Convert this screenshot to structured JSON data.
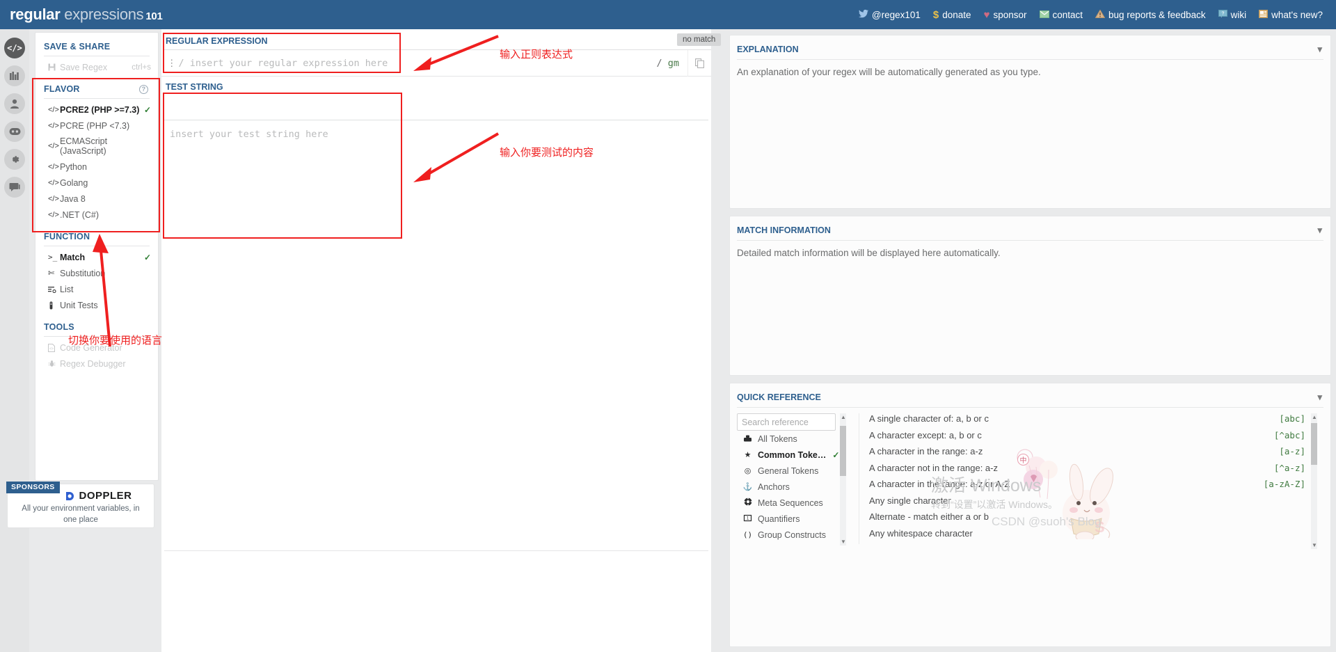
{
  "header": {
    "brand_regular": "regular",
    "brand_expressions": " expressions",
    "brand_101": "101",
    "nav": [
      {
        "icon": "twitter-icon",
        "glyph": "🐦",
        "label": "@regex101"
      },
      {
        "icon": "dollar-icon",
        "glyph": "$",
        "label": "donate"
      },
      {
        "icon": "heart-icon",
        "glyph": "♥",
        "label": "sponsor"
      },
      {
        "icon": "envelope-icon",
        "glyph": "✉",
        "label": "contact"
      },
      {
        "icon": "warning-icon",
        "glyph": "⚠",
        "label": "bug reports & feedback"
      },
      {
        "icon": "question-box-icon",
        "glyph": "?",
        "label": "wiki"
      },
      {
        "icon": "news-icon",
        "glyph": "☷",
        "label": "what's new?"
      }
    ]
  },
  "rail": [
    {
      "name": "code-icon",
      "glyph": "</>",
      "active": true
    },
    {
      "name": "library-icon",
      "glyph": "☷",
      "active": false
    },
    {
      "name": "account-icon",
      "glyph": "●",
      "active": false
    },
    {
      "name": "community-icon",
      "glyph": "◉",
      "active": false
    },
    {
      "name": "settings-icon",
      "glyph": "⚙",
      "active": false
    },
    {
      "name": "chat-icon",
      "glyph": "▣",
      "active": false
    }
  ],
  "sidebar": {
    "save_share_title": "SAVE & SHARE",
    "save_regex_label": "Save Regex",
    "save_regex_shortcut": "ctrl+s",
    "flavor_title": "FLAVOR",
    "flavor_help": "?",
    "flavors": [
      {
        "label": "PCRE2 (PHP >=7.3)",
        "selected": true
      },
      {
        "label": "PCRE (PHP <7.3)",
        "selected": false
      },
      {
        "label": "ECMAScript (JavaScript)",
        "selected": false
      },
      {
        "label": "Python",
        "selected": false
      },
      {
        "label": "Golang",
        "selected": false
      },
      {
        "label": "Java 8",
        "selected": false
      },
      {
        "label": ".NET (C#)",
        "selected": false
      }
    ],
    "function_title": "FUNCTION",
    "functions": [
      {
        "label": "Match",
        "icon": ">_",
        "selected": true
      },
      {
        "label": "Substitution",
        "icon": "✂",
        "selected": false
      },
      {
        "label": "List",
        "icon": "≡",
        "selected": false
      },
      {
        "label": "Unit Tests",
        "icon": "▮",
        "selected": false
      }
    ],
    "tools_title": "TOOLS",
    "tools": [
      {
        "label": "Code Generator",
        "icon": "⎘",
        "disabled": true
      },
      {
        "label": "Regex Debugger",
        "icon": "☣",
        "disabled": true
      }
    ]
  },
  "sponsors": {
    "tag": "SPONSORS",
    "name": "DOPPLER",
    "tagline": "All your environment variables, in one place"
  },
  "editor": {
    "regex_label": "REGULAR EXPRESSION",
    "regex_placeholder": "/ insert your regular expression here",
    "flags_slash": "/",
    "flags_value": "gm",
    "copy_icon": "⧉",
    "no_match_badge": "no match",
    "test_string_label": "TEST STRING",
    "test_string_placeholder": "insert your test string here"
  },
  "explanation": {
    "title": "EXPLANATION",
    "body": "An explanation of your regex will be automatically generated as you type."
  },
  "match_information": {
    "title": "MATCH INFORMATION",
    "body": "Detailed match information will be displayed here automatically."
  },
  "quick_reference": {
    "title": "QUICK REFERENCE",
    "search_placeholder": "Search reference",
    "categories": [
      {
        "label": "All Tokens",
        "icon": "▰",
        "selected": false
      },
      {
        "label": "Common Toke…",
        "icon": "★",
        "selected": true
      },
      {
        "label": "General Tokens",
        "icon": "◎",
        "selected": false
      },
      {
        "label": "Anchors",
        "icon": "⚓",
        "selected": false
      },
      {
        "label": "Meta Sequences",
        "icon": "❉",
        "selected": false
      },
      {
        "label": "Quantifiers",
        "icon": "⧉",
        "selected": false
      },
      {
        "label": "Group Constructs",
        "icon": "()",
        "selected": false
      }
    ],
    "entries": [
      {
        "desc": "A single character of: a, b or c",
        "token": "[abc]"
      },
      {
        "desc": "A character except: a, b or c",
        "token": "[^abc]"
      },
      {
        "desc": "A character in the range: a-z",
        "token": "[a-z]"
      },
      {
        "desc": "A character not in the range: a-z",
        "token": "[^a-z]"
      },
      {
        "desc": "A character in the range: a-z or A-Z",
        "token": "[a-zA-Z]"
      },
      {
        "desc": "Any single character",
        "token": ""
      },
      {
        "desc": "Alternate - match either a or b",
        "token": ""
      },
      {
        "desc": "Any whitespace character",
        "token": ""
      }
    ]
  },
  "annotations": {
    "regex_note": "输入正则表达式",
    "test_note": "输入你要测试的内容",
    "flavor_note": "切换你要使用的语言"
  },
  "watermarks": {
    "windows_line1": "激活 Windows",
    "windows_line2": "转到“设置”以激活 Windows。",
    "csdn": "CSDN @suoh's Blog",
    "ime": "中"
  },
  "colors": {
    "header_blue": "#2e5f8e",
    "annotation_red": "#ef1f1f",
    "check_green": "#2e7d32",
    "token_green": "#3f7a3f"
  }
}
